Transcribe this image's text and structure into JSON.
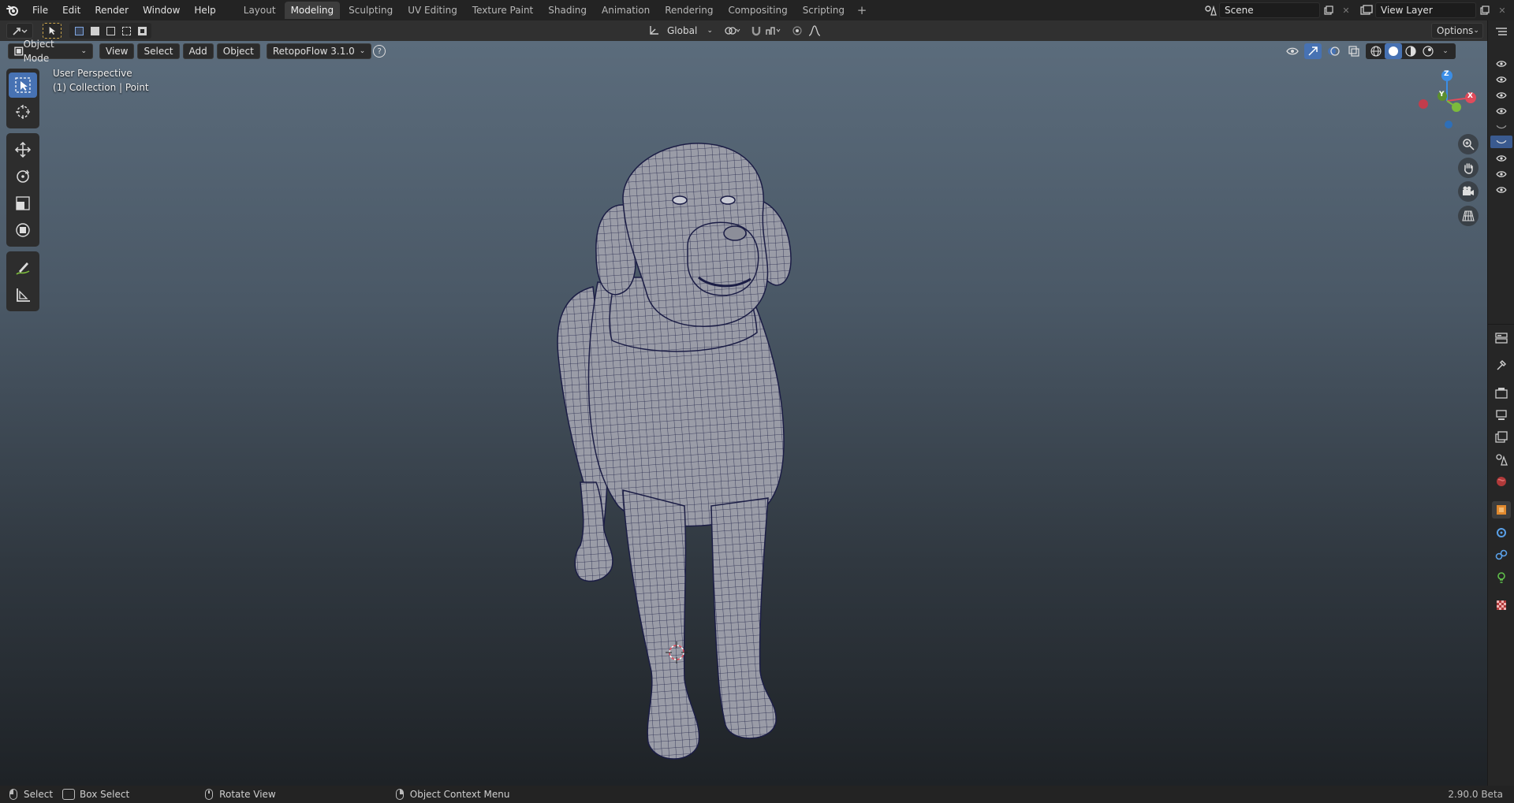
{
  "menu": {
    "items": [
      "File",
      "Edit",
      "Render",
      "Window",
      "Help"
    ]
  },
  "workspaces": {
    "tabs": [
      "Layout",
      "Modeling",
      "Sculpting",
      "UV Editing",
      "Texture Paint",
      "Shading",
      "Animation",
      "Rendering",
      "Compositing",
      "Scripting"
    ],
    "active": "Modeling"
  },
  "scene": {
    "name": "Scene"
  },
  "view_layer": {
    "name": "View Layer"
  },
  "header": {
    "transform_orientation": "Global",
    "options_label": "Options"
  },
  "viewport_header": {
    "mode": "Object Mode",
    "view": "View",
    "select": "Select",
    "add": "Add",
    "object": "Object",
    "addon": "RetopoFlow 3.1.0",
    "help": "?"
  },
  "viewport": {
    "perspective": "User Perspective",
    "collection": "(1) Collection | Point"
  },
  "gizmo": {
    "z": "Z",
    "y": "Y",
    "x": "X"
  },
  "tools": [
    "select-box",
    "cursor",
    "move",
    "rotate",
    "scale",
    "transform",
    "annotate",
    "measure"
  ],
  "statusbar": {
    "select": "Select",
    "box_select": "Box Select",
    "rotate_view": "Rotate View",
    "context_menu": "Object Context Menu",
    "version": "2.90.0 Beta"
  },
  "colors": {
    "accent": "#4772b3",
    "axis_x": "#e04b5b",
    "axis_y": "#7cbb3c",
    "axis_z": "#3b8ee6"
  }
}
